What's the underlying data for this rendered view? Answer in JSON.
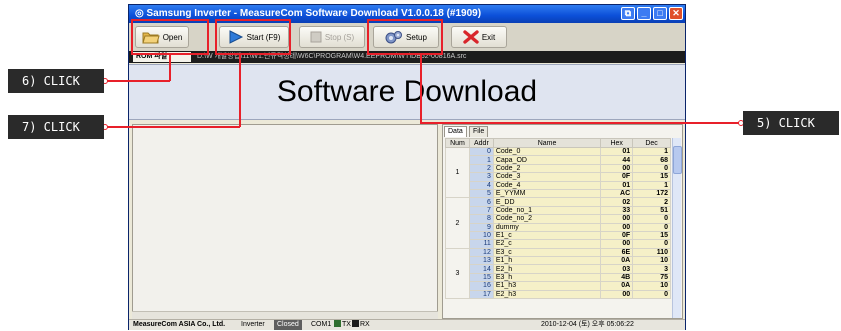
{
  "window": {
    "title": "◎ Samsung Inverter - MeasureCom Software Download V1.0.0.18 (#1909)",
    "controls": [
      "⧉",
      "_",
      "□",
      "✕"
    ]
  },
  "toolbar": {
    "open_label": "Open",
    "start_label": "Start (F9)",
    "stop_label": "Stop (S)",
    "setup_label": "Setup",
    "exit_label": "Exit"
  },
  "pathbar": {
    "rom_tab": "ROM 파일",
    "path": "D:\\W 개발방법\\11\\W1.년규격성테\\W6C\\PROGRAM\\W4.EEPROM\\WT\\DB62-00816A.src"
  },
  "banner": {
    "title": "Software Download"
  },
  "tabs": [
    "Data",
    "File"
  ],
  "grid": {
    "headers": [
      "Num",
      "Addr",
      "Name",
      "Hex",
      "Dec"
    ],
    "groups": [
      {
        "num": "1",
        "rows": [
          {
            "addr": "0",
            "name": "Code_0",
            "hex": "01",
            "dec": "1"
          },
          {
            "addr": "1",
            "name": "Capa_OD",
            "hex": "44",
            "dec": "68"
          },
          {
            "addr": "2",
            "name": "Code_2",
            "hex": "00",
            "dec": "0"
          },
          {
            "addr": "3",
            "name": "Code_3",
            "hex": "0F",
            "dec": "15"
          },
          {
            "addr": "4",
            "name": "Code_4",
            "hex": "01",
            "dec": "1"
          },
          {
            "addr": "5",
            "name": "E_YYMM",
            "hex": "AC",
            "dec": "172"
          }
        ]
      },
      {
        "num": "2",
        "rows": [
          {
            "addr": "6",
            "name": "E_DD",
            "hex": "02",
            "dec": "2"
          },
          {
            "addr": "7",
            "name": "Code_no_1",
            "hex": "33",
            "dec": "51"
          },
          {
            "addr": "8",
            "name": "Code_no_2",
            "hex": "00",
            "dec": "0"
          },
          {
            "addr": "9",
            "name": "dummy",
            "hex": "00",
            "dec": "0"
          },
          {
            "addr": "10",
            "name": "E1_c",
            "hex": "0F",
            "dec": "15"
          },
          {
            "addr": "11",
            "name": "E2_c",
            "hex": "00",
            "dec": "0"
          }
        ]
      },
      {
        "num": "3",
        "rows": [
          {
            "addr": "12",
            "name": "E3_c",
            "hex": "6E",
            "dec": "110"
          },
          {
            "addr": "13",
            "name": "E1_h",
            "hex": "0A",
            "dec": "10"
          },
          {
            "addr": "14",
            "name": "E2_h",
            "hex": "03",
            "dec": "3"
          },
          {
            "addr": "15",
            "name": "E3_h",
            "hex": "4B",
            "dec": "75"
          },
          {
            "addr": "16",
            "name": "E1_h3",
            "hex": "0A",
            "dec": "10"
          },
          {
            "addr": "17",
            "name": "E2_h3",
            "hex": "00",
            "dec": "0"
          }
        ]
      }
    ]
  },
  "statusbar": {
    "company": "MeasureCom ASIA Co., Ltd.",
    "inverter": "Inverter",
    "closed": "Closed",
    "com": "COM1",
    "tx": "TX",
    "rx": "RX",
    "datetime": "2010-12-04 (토) 오후 05:06:22"
  },
  "callouts": {
    "step6": "6) CLICK",
    "step7": "7) CLICK",
    "step5": "5) CLICK"
  },
  "colors": {
    "highlight": "#e8202a",
    "callout_bg": "#2a2a2a"
  }
}
